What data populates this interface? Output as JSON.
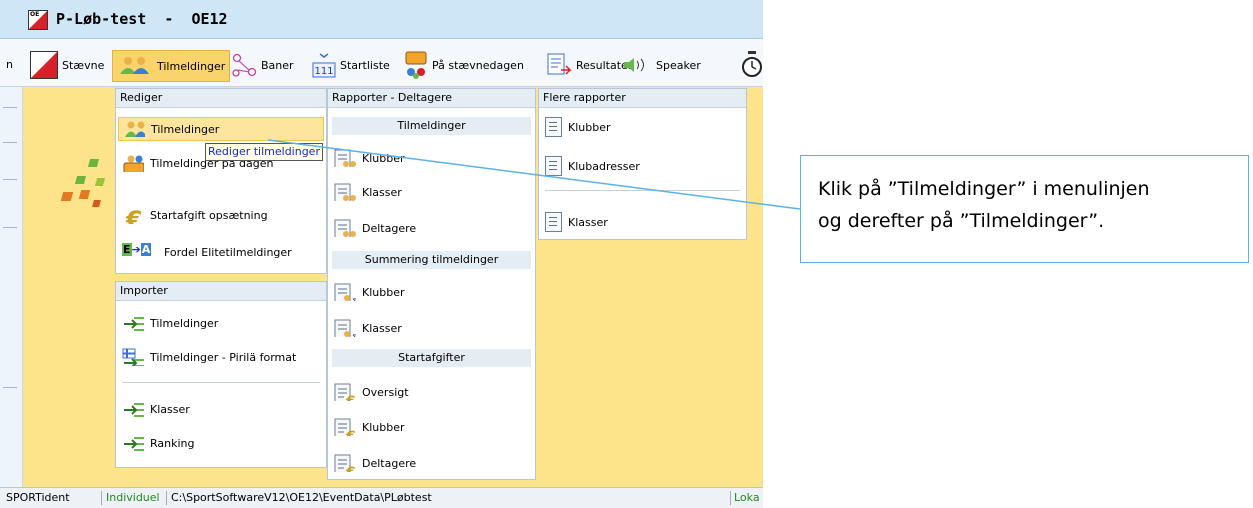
{
  "window": {
    "title": "P-Løb-test  -  OE12",
    "logo_text": "OE"
  },
  "menubar": {
    "left_cut": "n",
    "items": [
      {
        "label": "Stævne",
        "icon": "orienteering-flag-icon"
      },
      {
        "label": "Tilmeldinger",
        "icon": "people-icon",
        "active": true
      },
      {
        "label": "Baner",
        "icon": "course-icon"
      },
      {
        "label": "Startliste",
        "icon": "startlist-111-icon"
      },
      {
        "label": "På stævnedagen",
        "icon": "race-day-icon"
      },
      {
        "label": "Resultater",
        "icon": "results-icon"
      },
      {
        "label": "Speaker",
        "icon": "speaker-icon"
      }
    ]
  },
  "panels": {
    "rediger": {
      "title": "Rediger",
      "items": [
        {
          "label": "Tilmeldinger",
          "icon": "people-icon",
          "selected": true
        },
        {
          "label": "Tilmeldinger på dagen",
          "icon": "race-day-people-icon"
        },
        {
          "label": "Startafgift opsætning",
          "icon": "euro-icon"
        },
        {
          "label": "Fordel Elitetilmeldinger",
          "icon": "e-to-a-icon",
          "icon_text_e": "E",
          "icon_text_a": "A"
        }
      ]
    },
    "importer": {
      "title": "Importer",
      "items": [
        {
          "label": "Tilmeldinger",
          "icon": "import-arrow-icon"
        },
        {
          "label": "Tilmeldinger - Pirilä format",
          "icon": "import-finland-icon"
        },
        {
          "label": "Klasser",
          "icon": "import-arrow-icon"
        },
        {
          "label": "Ranking",
          "icon": "import-arrow-icon"
        }
      ]
    },
    "rapporter": {
      "title": "Rapporter - Deltagere",
      "groups": [
        {
          "title": "Tilmeldinger",
          "items": [
            "Klubber",
            "Klasser",
            "Deltagere"
          ]
        },
        {
          "title": "Summering tilmeldinger",
          "items": [
            "Klubber",
            "Klasser"
          ]
        },
        {
          "title": "Startafgifter",
          "items": [
            "Oversigt",
            "Klubber",
            "Deltagere"
          ]
        }
      ]
    },
    "flere": {
      "title": "Flere rapporter",
      "items": [
        "Klubber",
        "Klubadresser",
        "Klasser"
      ]
    }
  },
  "tooltip": "Rediger tilmeldinger",
  "statusbar": {
    "system": "SPORTident",
    "mode": "Individuel",
    "path": "C:\\SportSoftwareV12\\OE12\\EventData\\PLøbtest",
    "right": "Loka"
  },
  "callout": {
    "line1": "Klik på ”Tilmeldinger” i menulinjen",
    "line2": "og derefter på ”Tilmeldinger”."
  },
  "colors": {
    "background": "#fde48a",
    "title_bar": "#cfe6f6",
    "callout_border": "#5ab2e6",
    "tooltip_text": "#1a28c8",
    "status_mode": "#1e8a1e"
  }
}
